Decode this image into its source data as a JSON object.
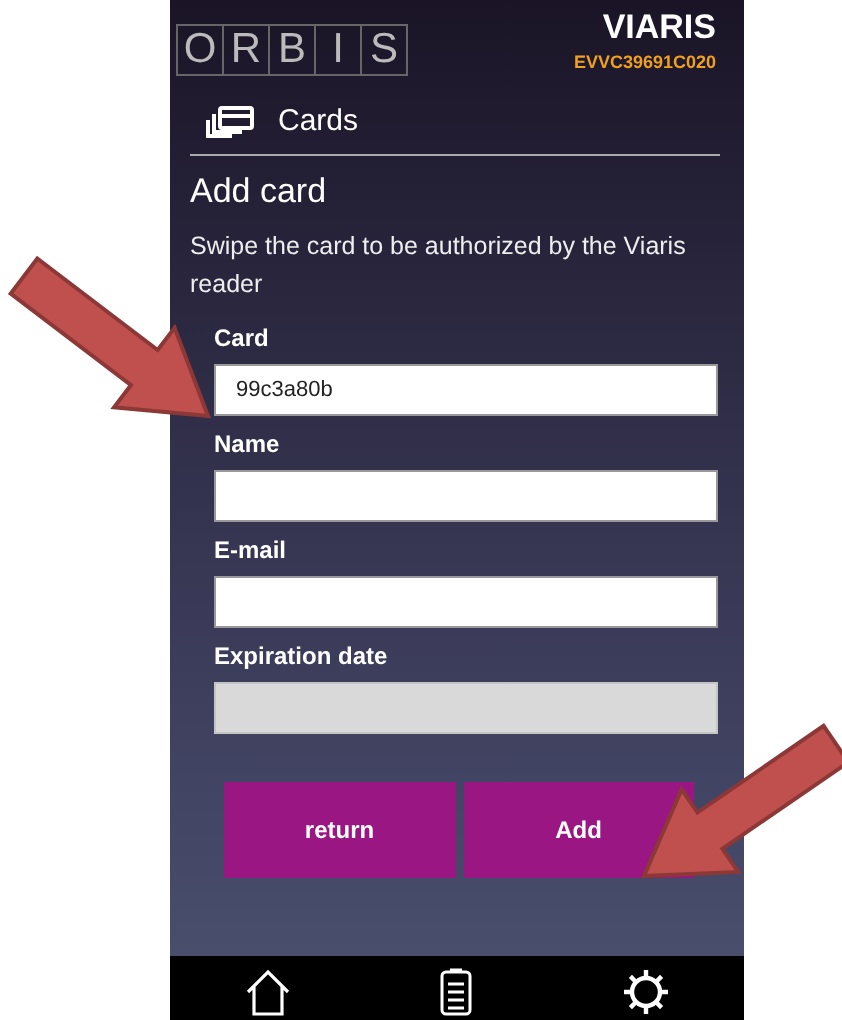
{
  "header": {
    "logo_letters": [
      "O",
      "R",
      "B",
      "I",
      "S"
    ],
    "brand": "VIARIS",
    "serial": "EVVC39691C020"
  },
  "section": {
    "title": "Cards"
  },
  "form": {
    "title": "Add card",
    "description": "Swipe the card to be authorized by the Viaris reader",
    "fields": [
      {
        "label": "Card",
        "value": "99c3a80b",
        "disabled": false
      },
      {
        "label": "Name",
        "disabled": false
      },
      {
        "label": "E-mail",
        "disabled": false
      },
      {
        "label": "Expiration date",
        "disabled": true
      }
    ],
    "buttons": [
      "return",
      "Add"
    ]
  },
  "nav": [
    {
      "kind": "home"
    },
    {
      "kind": "list"
    },
    {
      "kind": "settings"
    }
  ]
}
